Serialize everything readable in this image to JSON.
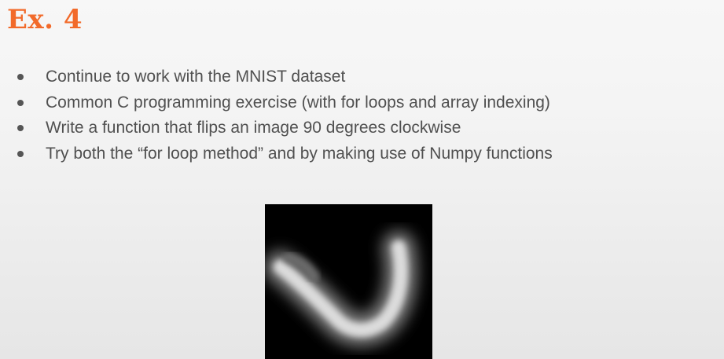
{
  "slide": {
    "title": "Ex. 4",
    "bullets": [
      "Continue to work with the MNIST dataset",
      "Common C programming exercise (with for loops and array indexing)",
      "Write a function that flips an image 90 degrees clockwise",
      "Try both the “for loop method” and by making use of Numpy functions"
    ]
  },
  "colors": {
    "title": "#f26a2a",
    "text": "#505050",
    "image_background": "#000000"
  }
}
